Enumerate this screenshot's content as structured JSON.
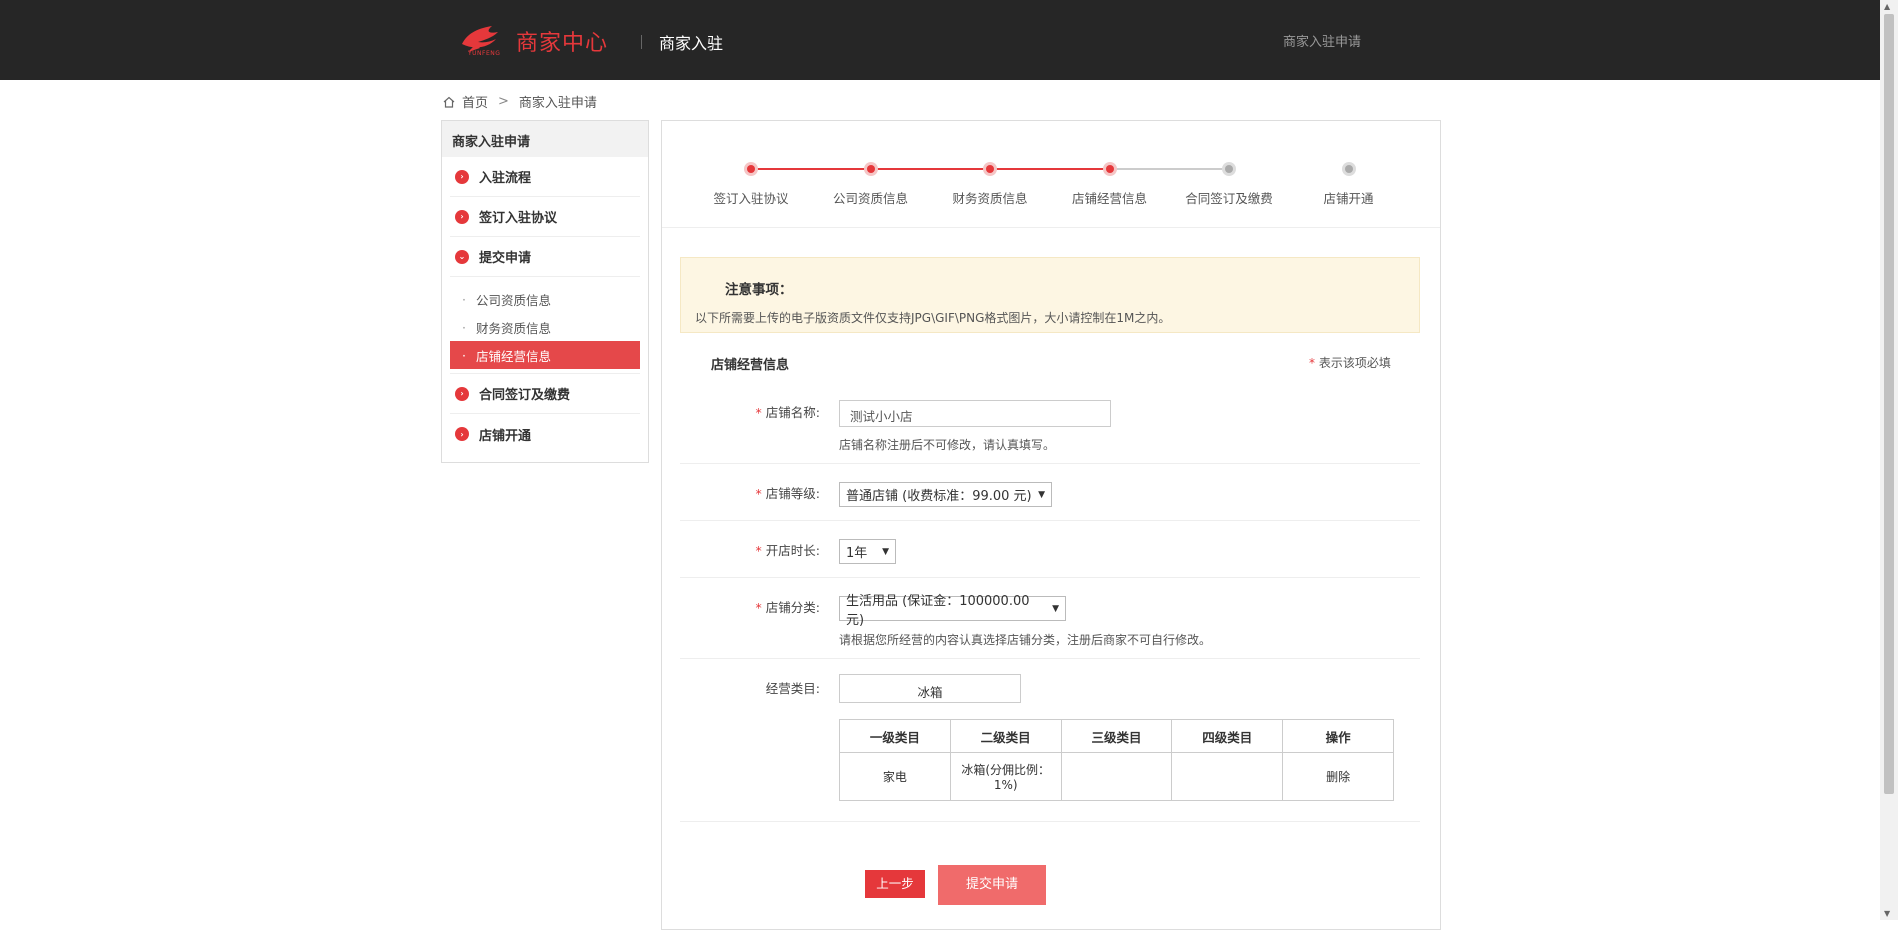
{
  "header": {
    "logo_text": "商家中心",
    "logo_sub": "YUNFENG",
    "title": "商家入驻",
    "right_link": "商家入驻申请"
  },
  "breadcrumb": {
    "home": "首页",
    "current": "商家入驻申请"
  },
  "sidebar": {
    "title": "商家入驻申请",
    "items": [
      {
        "label": "入驻流程"
      },
      {
        "label": "签订入驻协议"
      },
      {
        "label": "提交申请"
      },
      {
        "label": "合同签订及缴费"
      },
      {
        "label": "店铺开通"
      }
    ],
    "sub_items": [
      {
        "label": "公司资质信息"
      },
      {
        "label": "财务资质信息"
      },
      {
        "label": "店铺经营信息"
      }
    ]
  },
  "steps": [
    {
      "label": "签订入驻协议",
      "done": true
    },
    {
      "label": "公司资质信息",
      "done": true
    },
    {
      "label": "财务资质信息",
      "done": true
    },
    {
      "label": "店铺经营信息",
      "done": true
    },
    {
      "label": "合同签订及缴费",
      "done": false
    },
    {
      "label": "店铺开通",
      "done": false
    }
  ],
  "notice": {
    "title": "注意事项：",
    "text": "以下所需要上传的电子版资质文件仅支持JPG\\GIF\\PNG格式图片，大小请控制在1M之内。"
  },
  "section": {
    "title": "店铺经营信息",
    "required_star": "*",
    "required_note": "表示该项必填"
  },
  "form": {
    "star": "*",
    "shop_name_label": "店铺名称:",
    "shop_name_value": "测试小小店",
    "shop_name_hint": "店铺名称注册后不可修改，请认真填写。",
    "shop_level_label": "店铺等级:",
    "shop_level_value": "普通店铺 (收费标准：99.00 元)",
    "duration_label": "开店时长:",
    "duration_value": "1年",
    "category_label": "店铺分类:",
    "category_value": "生活用品 (保证金：100000.00元)",
    "category_hint": "请根据您所经营的内容认真选择店铺分类，注册后商家不可自行修改。",
    "business_label": "经营类目:",
    "business_value": "冰箱"
  },
  "table": {
    "headers": [
      "一级类目",
      "二级类目",
      "三级类目",
      "四级类目",
      "操作"
    ],
    "rows": [
      {
        "c1": "家电",
        "c2": "冰箱(分佣比例：1%)",
        "c3": "",
        "c4": "",
        "action": "删除"
      }
    ]
  },
  "buttons": {
    "prev": "上一步",
    "submit": "提交申请"
  },
  "colors": {
    "accent": "#e5383b",
    "topbar": "#262626",
    "notice_bg": "#fdf6e3"
  }
}
